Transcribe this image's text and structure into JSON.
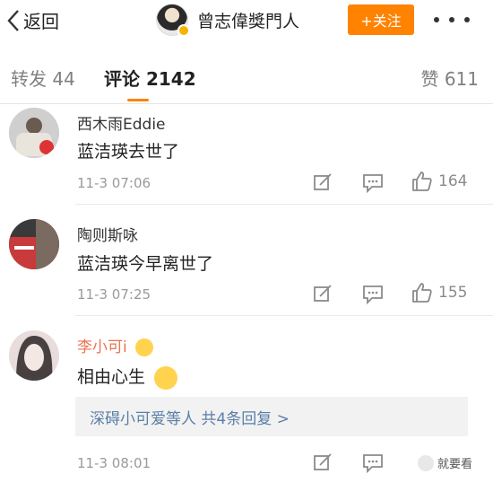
{
  "header": {
    "back_label": "返回",
    "profile_name": "曾志偉獎門人",
    "follow_label": "+关注"
  },
  "tabs": {
    "repost": "转发 44",
    "comment": "评论 2142",
    "like": "赞 611"
  },
  "comments": [
    {
      "name": "西木雨Eddie",
      "text": "蓝洁瑛去世了",
      "time": "11-3 07:06",
      "likes": "164"
    },
    {
      "name": "陶则斯咏",
      "text": "蓝洁瑛今早离世了",
      "time": "11-3 07:25",
      "likes": "155"
    },
    {
      "name": "李小可i",
      "text": "相由心生",
      "time": "11-3 08:01",
      "replies": "深碍小可爱等人 共4条回复 >"
    }
  ],
  "watermark": "就要看",
  "colors": {
    "accent": "#ff8200",
    "link": "#5a7fa6",
    "vip_name": "#eb7350"
  }
}
